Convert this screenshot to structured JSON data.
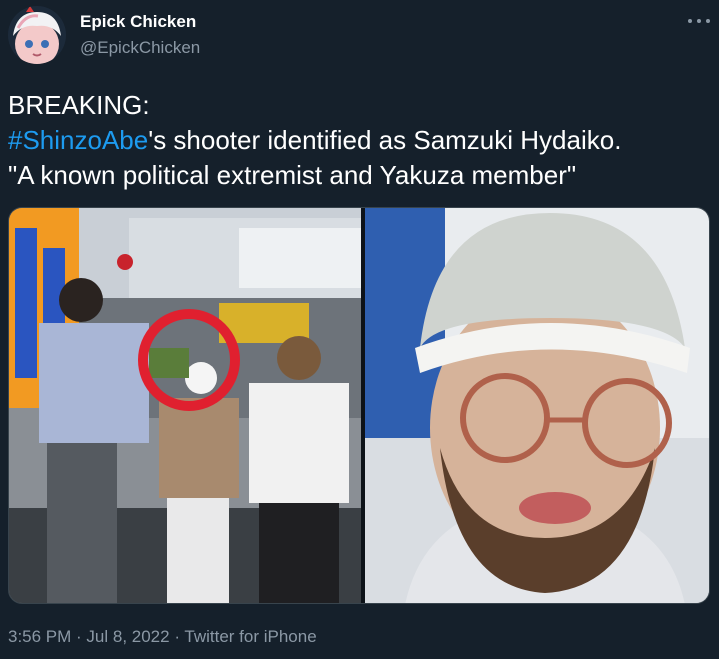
{
  "author": {
    "display_name": "Epick Chicken",
    "handle": "@EpickChicken",
    "avatar_icon": "anime-avatar-icon"
  },
  "tweet": {
    "line1": "BREAKING:",
    "hashtag": "#ShinzoAbe",
    "line2_rest": "'s shooter identified as Samzuki Hydaiko.",
    "line3": "\"A known political extremist and Yakuza member\""
  },
  "media": {
    "left_photo": "crowd-scene-photo",
    "right_photo": "bearded-man-selfie-photo",
    "highlight_color": "#e0202f"
  },
  "meta": {
    "timestamp": "3:56 PM · Jul 8, 2022 · Twitter for iPhone"
  },
  "colors": {
    "background": "#15202b",
    "text": "#ffffff",
    "secondary": "#8b98a5",
    "link": "#1d9bf0"
  }
}
